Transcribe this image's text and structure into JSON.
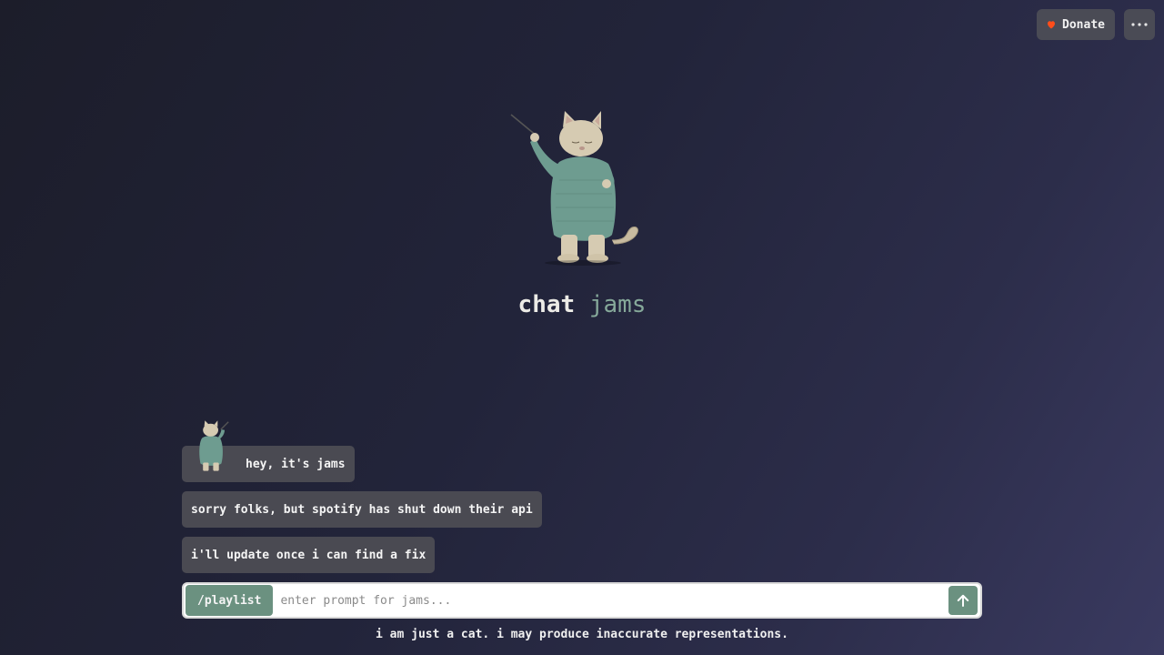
{
  "header": {
    "donate_label": "Donate",
    "donate_icon": "heart-icon",
    "more_icon": "more-horizontal-icon",
    "accent_heart": "#ff4d1a"
  },
  "hero": {
    "title_word1": "chat",
    "title_word2": "jams",
    "title_word2_color": "#86a99a"
  },
  "chat": {
    "messages": [
      {
        "text": "hey, it's jams"
      },
      {
        "text": "sorry folks, but spotify has shut down their api"
      },
      {
        "text": "i'll update once i can find a fix"
      }
    ]
  },
  "composer": {
    "command_label": "/playlist",
    "placeholder": "enter prompt for jams...",
    "value": "",
    "send_icon": "arrow-up-icon",
    "accent": "#6b9180"
  },
  "footer": {
    "disclaimer": "i am just a cat. i may produce inaccurate representations."
  }
}
